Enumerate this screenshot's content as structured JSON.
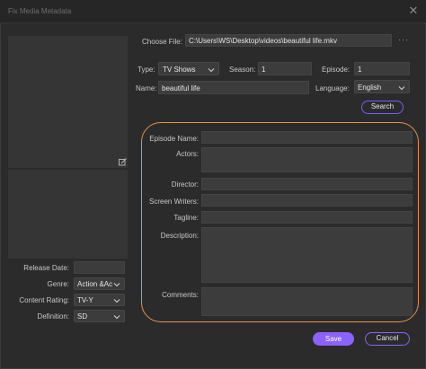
{
  "window": {
    "title": "Fix Media Metadata",
    "close_glyph": "✕"
  },
  "file": {
    "label": "Choose File:",
    "path": "C:\\Users\\WS\\Desktop\\videos\\beautiful life.mkv",
    "browse_glyph": "···"
  },
  "type": {
    "label": "Type:",
    "value": "TV Shows"
  },
  "season": {
    "label": "Season:",
    "value": "1"
  },
  "episode": {
    "label": "Episode:",
    "value": "1"
  },
  "name": {
    "label": "Name:",
    "value": "beautiful life"
  },
  "language": {
    "label": "Language:",
    "value": "English"
  },
  "search_button": "Search",
  "details": {
    "episode_name_label": "Episode Name:",
    "actors_label": "Actors:",
    "director_label": "Director:",
    "screen_writers_label": "Screen Writers:",
    "tagline_label": "Tagline:",
    "description_label": "Description:",
    "comments_label": "Comments:"
  },
  "left": {
    "release_date_label": "Release Date:",
    "genre_label": "Genre:",
    "genre_value": "Action &Ac",
    "content_rating_label": "Content Rating:",
    "content_rating_value": "TV-Y",
    "definition_label": "Definition:",
    "definition_value": "SD"
  },
  "buttons": {
    "save": "Save",
    "cancel": "Cancel"
  },
  "icons": {
    "edit": "edit-icon",
    "chevron": "chevron-down-icon",
    "close": "close-icon"
  },
  "colors": {
    "accent": "#8c62ff",
    "highlight": "#e8914a"
  }
}
